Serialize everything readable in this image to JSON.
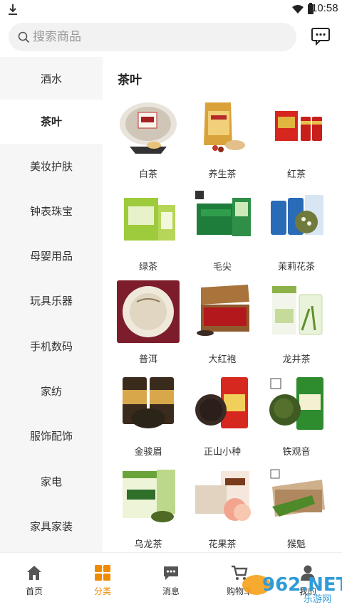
{
  "status_bar": {
    "time": "10:58"
  },
  "search": {
    "placeholder": "搜索商品"
  },
  "sidebar": {
    "items": [
      {
        "label": "酒水"
      },
      {
        "label": "茶叶"
      },
      {
        "label": "美妆护肤"
      },
      {
        "label": "钟表珠宝"
      },
      {
        "label": "母婴用品"
      },
      {
        "label": "玩具乐器"
      },
      {
        "label": "手机数码"
      },
      {
        "label": "家纺"
      },
      {
        "label": "服饰配饰"
      },
      {
        "label": "家电"
      },
      {
        "label": "家具家装"
      }
    ],
    "active_index": 1
  },
  "content": {
    "title": "茶叶",
    "items": [
      {
        "label": "白茶",
        "icon": "white-tea-image"
      },
      {
        "label": "养生茶",
        "icon": "health-tea-image"
      },
      {
        "label": "红茶",
        "icon": "black-tea-image"
      },
      {
        "label": "绿茶",
        "icon": "green-tea-image"
      },
      {
        "label": "毛尖",
        "icon": "maojian-tea-image"
      },
      {
        "label": "茉莉花茶",
        "icon": "jasmine-tea-image"
      },
      {
        "label": "普洱",
        "icon": "puer-tea-image"
      },
      {
        "label": "大红袍",
        "icon": "dahongpao-tea-image"
      },
      {
        "label": "龙井茶",
        "icon": "longjing-tea-image"
      },
      {
        "label": "金骏眉",
        "icon": "jinjunmei-tea-image"
      },
      {
        "label": "正山小种",
        "icon": "zhengshan-tea-image"
      },
      {
        "label": "铁观音",
        "icon": "tieguanyin-tea-image"
      },
      {
        "label": "乌龙茶",
        "icon": "oolong-tea-image"
      },
      {
        "label": "花果茶",
        "icon": "fruit-tea-image"
      },
      {
        "label": "猴魁",
        "icon": "houkui-tea-image"
      }
    ]
  },
  "bottom_nav": {
    "items": [
      {
        "label": "首页",
        "icon": "home-icon"
      },
      {
        "label": "分类",
        "icon": "category-icon"
      },
      {
        "label": "消息",
        "icon": "message-icon"
      },
      {
        "label": "购物车",
        "icon": "cart-icon"
      },
      {
        "label": "我的",
        "icon": "user-icon"
      }
    ],
    "active_index": 1
  },
  "watermark": {
    "text": "962.NET",
    "subtext": "乐游网"
  },
  "colors": {
    "accent": "#f08a00",
    "sidebar_bg": "#f6f6f6",
    "search_bg": "#f2f2f2"
  }
}
